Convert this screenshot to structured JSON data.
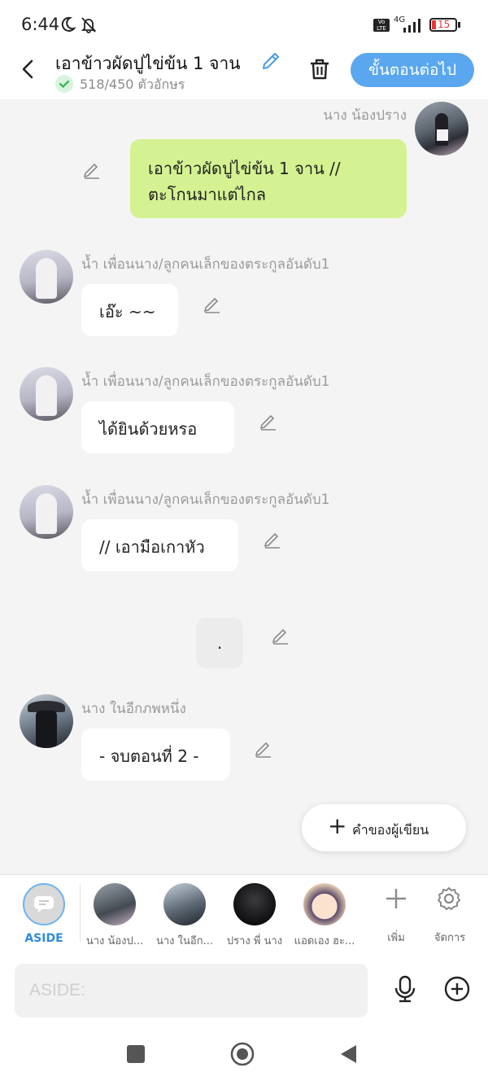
{
  "status": {
    "time": "6:44",
    "network": "4G",
    "battery": "15"
  },
  "header": {
    "title": "เอาข้าวผัดปูไข่ข้น 1 จาน",
    "char_count": "518/450 ตัวอักษร",
    "next_button": "ขั้นตอนต่อไป"
  },
  "messages": [
    {
      "name": "นาง น้องปราง",
      "text_line1": "เอาข้าวผัดปูไข่ข้น 1 จาน //",
      "text_line2": "ตะโกนมาแต่ไกล"
    },
    {
      "name": "น้ำ เพื่อนนาง/ลูกคนเล็กของตระกูลอันดับ1",
      "text": "เอ๊ะ ~~"
    },
    {
      "name": "น้ำ เพื่อนนาง/ลูกคนเล็กของตระกูลอันดับ1",
      "text": "ได้ยินด้วยหรอ"
    },
    {
      "name": "น้ำ เพื่อนนาง/ลูกคนเล็กของตระกูลอันดับ1",
      "text": "// เอามือเกาหัว"
    },
    {
      "text": "."
    },
    {
      "name": "นาง ในอีกภพหนึ่ง",
      "text": "- จบตอนที่ 2 -"
    }
  ],
  "fab": {
    "label": "คำของผู้เขียน"
  },
  "characters": [
    {
      "label": "ASIDE",
      "icon": "chat-bubble-icon"
    },
    {
      "label": "นาง น้องป..."
    },
    {
      "label": "นาง ในอีก..."
    },
    {
      "label": "ปราง พี่ นาง"
    },
    {
      "label": "แอดเอง ฮะ..."
    }
  ],
  "char_actions": {
    "add": "เพิ่ม",
    "manage": "จัดการ"
  },
  "input": {
    "placeholder": "ASIDE:"
  },
  "colors": {
    "accent": "#5aa7ef",
    "my_bubble": "#d4f291",
    "aside": "#2f8ae0"
  }
}
